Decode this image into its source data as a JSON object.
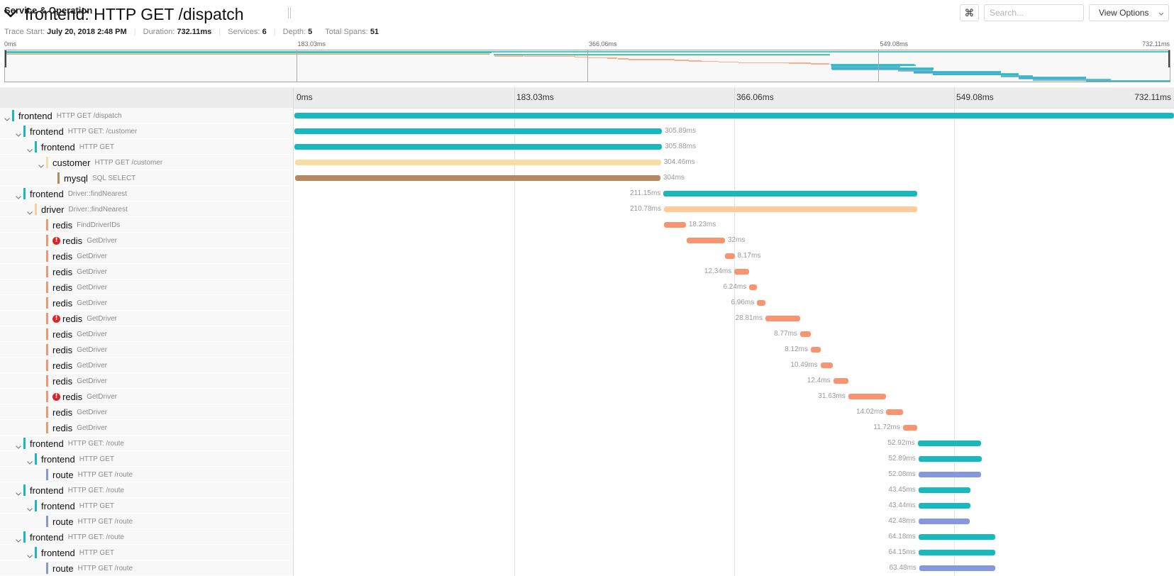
{
  "header": {
    "title": "frontend: HTTP GET /dispatch",
    "collapse_icon": "chevron-down-icon",
    "meta": {
      "trace_start_label": "Trace Start:",
      "trace_start": "July 20, 2018 2:48 PM",
      "duration_label": "Duration:",
      "duration": "732.11ms",
      "services_label": "Services:",
      "services": "6",
      "depth_label": "Depth:",
      "depth": "5",
      "total_spans_label": "Total Spans:",
      "total_spans": "51"
    },
    "keyboard_shortcuts_label": "⌘",
    "search_placeholder": "Search...",
    "search_value": "",
    "view_options_label": "View Options",
    "view_options_icon": "chevron-down-icon"
  },
  "trace": {
    "duration_ms": 732.11
  },
  "minimap": {
    "ticks": [
      {
        "value": 0,
        "label": "0ms"
      },
      {
        "value": 183.03,
        "label": "183.03ms"
      },
      {
        "value": 366.06,
        "label": "366.06ms"
      },
      {
        "value": 549.08,
        "label": "549.08ms"
      },
      {
        "value": 732.11,
        "label": "732.11ms"
      }
    ],
    "unlisted_route_groups": [
      {
        "start_ms": 561.5,
        "duration_ms": 21.5
      },
      {
        "start_ms": 571.0,
        "duration_ms": 55.0
      },
      {
        "start_ms": 583.0,
        "duration_ms": 54.0
      },
      {
        "start_ms": 626.0,
        "duration_ms": 20.0
      },
      {
        "start_ms": 637.0,
        "duration_ms": 42.5
      },
      {
        "start_ms": 646.0,
        "duration_ms": 49.0
      },
      {
        "start_ms": 679.5,
        "duration_ms": 52.6
      }
    ],
    "unlisted_group_services": [
      "frontend",
      "frontend",
      "route"
    ]
  },
  "timeline": {
    "column_header": "Service & Operation",
    "ticks": [
      {
        "value": 0,
        "label": "0ms"
      },
      {
        "value": 183.03,
        "label": "183.03ms"
      },
      {
        "value": 366.06,
        "label": "366.06ms"
      },
      {
        "value": 549.08,
        "label": "549.08ms"
      },
      {
        "value": 732.11,
        "label": "732.11ms"
      }
    ]
  },
  "colors": {
    "frontend": "#17b8be",
    "customer": "#f8dca1",
    "mysql": "#b7885e",
    "driver": "#ffcb99",
    "redis": "#f89570",
    "route": "#8497e0",
    "error": "#d8262a"
  },
  "spans": [
    {
      "service": "frontend",
      "operation": "HTTP GET /dispatch",
      "depth": 0,
      "collapsible": true,
      "error": false,
      "start_ms": 0,
      "duration_ms": 732.11,
      "duration_label": "",
      "label_side": "none"
    },
    {
      "service": "frontend",
      "operation": "HTTP GET: /customer",
      "depth": 1,
      "collapsible": true,
      "error": false,
      "start_ms": 0,
      "duration_ms": 305.89,
      "duration_label": "305.89ms",
      "label_side": "right"
    },
    {
      "service": "frontend",
      "operation": "HTTP GET",
      "depth": 2,
      "collapsible": true,
      "error": false,
      "start_ms": 0,
      "duration_ms": 305.88,
      "duration_label": "305.88ms",
      "label_side": "right"
    },
    {
      "service": "customer",
      "operation": "HTTP GET /customer",
      "depth": 3,
      "collapsible": true,
      "error": false,
      "start_ms": 0.6,
      "duration_ms": 304.46,
      "duration_label": "304.46ms",
      "label_side": "right"
    },
    {
      "service": "mysql",
      "operation": "SQL SELECT",
      "depth": 4,
      "collapsible": false,
      "error": false,
      "start_ms": 0.6,
      "duration_ms": 304,
      "duration_label": "304ms",
      "label_side": "right"
    },
    {
      "service": "frontend",
      "operation": "Driver::findNearest",
      "depth": 1,
      "collapsible": true,
      "error": false,
      "start_ms": 307.2,
      "duration_ms": 211.15,
      "duration_label": "211.15ms",
      "label_side": "left"
    },
    {
      "service": "driver",
      "operation": "Driver::findNearest",
      "depth": 2,
      "collapsible": true,
      "error": false,
      "start_ms": 307.6,
      "duration_ms": 210.78,
      "duration_label": "210.78ms",
      "label_side": "left"
    },
    {
      "service": "redis",
      "operation": "FindDriverIDs",
      "depth": 3,
      "collapsible": false,
      "error": false,
      "start_ms": 307.6,
      "duration_ms": 18.23,
      "duration_label": "18.23ms",
      "label_side": "right"
    },
    {
      "service": "redis",
      "operation": "GetDriver",
      "depth": 3,
      "collapsible": false,
      "error": true,
      "start_ms": 326.3,
      "duration_ms": 32,
      "duration_label": "32ms",
      "label_side": "right"
    },
    {
      "service": "redis",
      "operation": "GetDriver",
      "depth": 3,
      "collapsible": false,
      "error": false,
      "start_ms": 358.2,
      "duration_ms": 8.17,
      "duration_label": "8.17ms",
      "label_side": "right"
    },
    {
      "service": "redis",
      "operation": "GetDriver",
      "depth": 3,
      "collapsible": false,
      "error": false,
      "start_ms": 366.2,
      "duration_ms": 12.34,
      "duration_label": "12.34ms",
      "label_side": "left"
    },
    {
      "service": "redis",
      "operation": "GetDriver",
      "depth": 3,
      "collapsible": false,
      "error": false,
      "start_ms": 378.6,
      "duration_ms": 6.24,
      "duration_label": "6.24ms",
      "label_side": "left"
    },
    {
      "service": "redis",
      "operation": "GetDriver",
      "depth": 3,
      "collapsible": false,
      "error": false,
      "start_ms": 385.1,
      "duration_ms": 6.96,
      "duration_label": "6.96ms",
      "label_side": "left"
    },
    {
      "service": "redis",
      "operation": "GetDriver",
      "depth": 3,
      "collapsible": false,
      "error": true,
      "start_ms": 392.0,
      "duration_ms": 28.81,
      "duration_label": "28.81ms",
      "label_side": "left"
    },
    {
      "service": "redis",
      "operation": "GetDriver",
      "depth": 3,
      "collapsible": false,
      "error": false,
      "start_ms": 420.9,
      "duration_ms": 8.77,
      "duration_label": "8.77ms",
      "label_side": "left"
    },
    {
      "service": "redis",
      "operation": "GetDriver",
      "depth": 3,
      "collapsible": false,
      "error": false,
      "start_ms": 429.8,
      "duration_ms": 8.12,
      "duration_label": "8.12ms",
      "label_side": "left"
    },
    {
      "service": "redis",
      "operation": "GetDriver",
      "depth": 3,
      "collapsible": false,
      "error": false,
      "start_ms": 437.9,
      "duration_ms": 10.49,
      "duration_label": "10.49ms",
      "label_side": "left"
    },
    {
      "service": "redis",
      "operation": "GetDriver",
      "depth": 3,
      "collapsible": false,
      "error": false,
      "start_ms": 448.5,
      "duration_ms": 12.4,
      "duration_label": "12.4ms",
      "label_side": "left"
    },
    {
      "service": "redis",
      "operation": "GetDriver",
      "depth": 3,
      "collapsible": false,
      "error": true,
      "start_ms": 460.9,
      "duration_ms": 31.63,
      "duration_label": "31.63ms",
      "label_side": "left"
    },
    {
      "service": "redis",
      "operation": "GetDriver",
      "depth": 3,
      "collapsible": false,
      "error": false,
      "start_ms": 492.6,
      "duration_ms": 14.02,
      "duration_label": "14.02ms",
      "label_side": "left"
    },
    {
      "service": "redis",
      "operation": "GetDriver",
      "depth": 3,
      "collapsible": false,
      "error": false,
      "start_ms": 506.5,
      "duration_ms": 11.72,
      "duration_label": "11.72ms",
      "label_side": "left"
    },
    {
      "service": "frontend",
      "operation": "HTTP GET: /route",
      "depth": 1,
      "collapsible": true,
      "error": false,
      "start_ms": 518.8,
      "duration_ms": 52.92,
      "duration_label": "52.92ms",
      "label_side": "left"
    },
    {
      "service": "frontend",
      "operation": "HTTP GET",
      "depth": 2,
      "collapsible": true,
      "error": false,
      "start_ms": 519.4,
      "duration_ms": 52.89,
      "duration_label": "52.89ms",
      "label_side": "left"
    },
    {
      "service": "route",
      "operation": "HTTP GET /route",
      "depth": 3,
      "collapsible": false,
      "error": false,
      "start_ms": 519.4,
      "duration_ms": 52.08,
      "duration_label": "52.08ms",
      "label_side": "left"
    },
    {
      "service": "frontend",
      "operation": "HTTP GET: /route",
      "depth": 1,
      "collapsible": true,
      "error": false,
      "start_ms": 519.4,
      "duration_ms": 43.45,
      "duration_label": "43.45ms",
      "label_side": "left"
    },
    {
      "service": "frontend",
      "operation": "HTTP GET",
      "depth": 2,
      "collapsible": true,
      "error": false,
      "start_ms": 519.4,
      "duration_ms": 43.44,
      "duration_label": "43.44ms",
      "label_side": "left"
    },
    {
      "service": "route",
      "operation": "HTTP GET /route",
      "depth": 3,
      "collapsible": false,
      "error": false,
      "start_ms": 519.4,
      "duration_ms": 42.48,
      "duration_label": "42.48ms",
      "label_side": "left"
    },
    {
      "service": "frontend",
      "operation": "HTTP GET: /route",
      "depth": 1,
      "collapsible": true,
      "error": false,
      "start_ms": 519.4,
      "duration_ms": 64.18,
      "duration_label": "64.18ms",
      "label_side": "left"
    },
    {
      "service": "frontend",
      "operation": "HTTP GET",
      "depth": 2,
      "collapsible": true,
      "error": false,
      "start_ms": 519.4,
      "duration_ms": 64.15,
      "duration_label": "64.15ms",
      "label_side": "left"
    },
    {
      "service": "route",
      "operation": "HTTP GET /route",
      "depth": 3,
      "collapsible": false,
      "error": false,
      "start_ms": 520.1,
      "duration_ms": 63.48,
      "duration_label": "63.48ms",
      "label_side": "left"
    }
  ]
}
